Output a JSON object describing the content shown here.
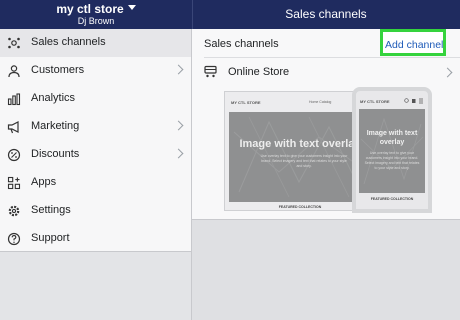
{
  "header": {
    "store_name": "my ctl store",
    "user_name": "Dj Brown",
    "page_title": "Sales channels"
  },
  "sidebar": {
    "items": [
      {
        "label": "Sales channels",
        "icon": "sales-channels-icon"
      },
      {
        "label": "Customers",
        "icon": "customers-icon"
      },
      {
        "label": "Analytics",
        "icon": "analytics-icon"
      },
      {
        "label": "Marketing",
        "icon": "marketing-icon"
      },
      {
        "label": "Discounts",
        "icon": "discounts-icon"
      },
      {
        "label": "Apps",
        "icon": "apps-icon"
      },
      {
        "label": "Settings",
        "icon": "settings-icon"
      },
      {
        "label": "Support",
        "icon": "support-icon"
      }
    ]
  },
  "main": {
    "section_title": "Sales channels",
    "add_channel_label": "Add channel",
    "channels": [
      {
        "name": "Online Store",
        "icon": "online-store-icon"
      }
    ],
    "preview": {
      "desktop": {
        "store_label": "MY CTL STORE",
        "nav_items": "Home   Catalog",
        "hero_title": "Image with text overlay",
        "hero_body": "Use overlay text to give your customers insight into your brand. Select imagery and text that relates to your style and story.",
        "featured_label": "FEATURED COLLECTION"
      },
      "mobile": {
        "store_label": "MY CTL STORE",
        "hero_title": "Image with text overlay",
        "hero_body": "Use overlay text to give your customers insight into your brand. Select imagery and text that relates to your style and story.",
        "featured_label": "FEATURED COLLECTION"
      }
    }
  },
  "colors": {
    "topbar": "#1f2b5f",
    "highlight": "#35d33d",
    "link": "#1f5bb8"
  }
}
